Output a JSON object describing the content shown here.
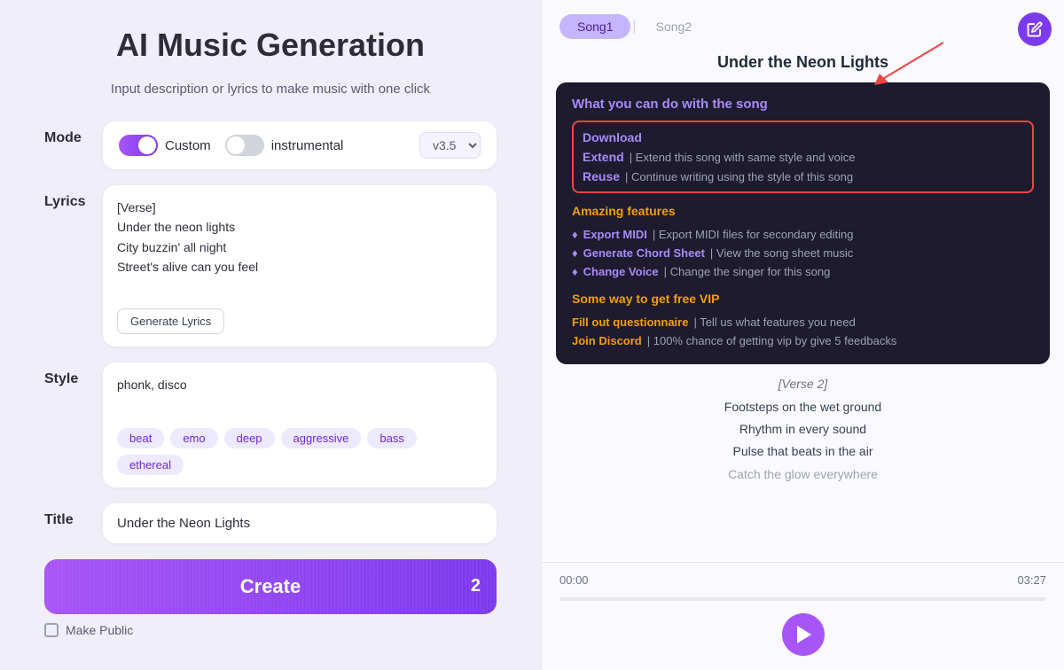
{
  "header": {
    "title": "AI Music Generation",
    "subtitle": "Input description or lyrics to make music with one click"
  },
  "mode_section": {
    "label": "Mode",
    "custom_label": "Custom",
    "instrumental_label": "instrumental",
    "version": "v3.5",
    "custom_active": true,
    "instrumental_active": false
  },
  "lyrics_section": {
    "label": "Lyrics",
    "content": "[Verse]\nUnder the neon lights\nCity buzzin' all night\nStreet's alive can you feel",
    "generate_btn": "Generate Lyrics"
  },
  "style_section": {
    "label": "Style",
    "content": "phonk, disco",
    "tags": [
      "beat",
      "emo",
      "deep",
      "aggressive",
      "bass",
      "ethereal"
    ]
  },
  "title_section": {
    "label": "Title",
    "value": "Under the Neon Lights"
  },
  "create_btn": {
    "label": "Create",
    "count": "2"
  },
  "make_public": "Make Public",
  "right_panel": {
    "tabs": [
      "Song1",
      "Song2"
    ],
    "active_tab": "Song1",
    "song_title": "Under the Neon Lights",
    "dropdown": {
      "what_section": {
        "title": "What you can do with the song",
        "actions": [
          {
            "main": "Download",
            "desc": ""
          },
          {
            "main": "Extend",
            "desc": "| Extend this song with same style and voice"
          },
          {
            "main": "Reuse",
            "desc": "| Continue writing using the style of this song"
          }
        ]
      },
      "features_section": {
        "title": "Amazing features",
        "items": [
          {
            "main": "Export MIDI",
            "desc": "| Export MIDI files for secondary editing"
          },
          {
            "main": "Generate Chord Sheet",
            "desc": "| View the song sheet music"
          },
          {
            "main": "Change Voice",
            "desc": "| Change the singer for this song"
          }
        ]
      },
      "vip_section": {
        "title": "Some way to get free VIP",
        "items": [
          {
            "main": "Fill out questionnaire",
            "desc": "| Tell us what features you need"
          },
          {
            "main": "Join Discord",
            "desc": "| 100% chance of getting vip by give 5 feedbacks"
          }
        ]
      }
    },
    "lyrics": {
      "verse_label": "[Verse 2]",
      "lines": [
        "Footsteps on the wet ground",
        "Rhythm in every sound",
        "Pulse that beats in the air",
        "Catch the glow everywhere"
      ]
    },
    "player": {
      "time_current": "00:00",
      "time_total": "03:27"
    }
  }
}
